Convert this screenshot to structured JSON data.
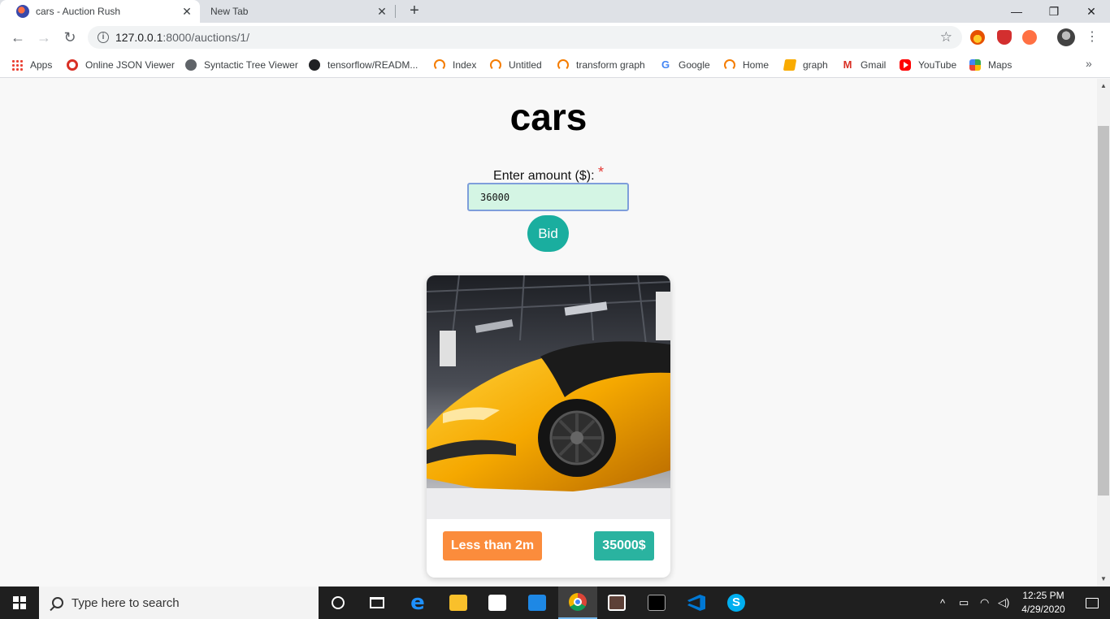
{
  "browser": {
    "tabs": [
      {
        "title": "cars - Auction Rush",
        "close": "✕"
      },
      {
        "title": "New Tab",
        "close": "✕"
      }
    ],
    "new_tab": "+",
    "window_controls": {
      "minimize": "—",
      "maximize": "❐",
      "close": "✕"
    },
    "nav": {
      "back": "←",
      "forward": "→",
      "reload": "↻"
    },
    "url_host": "127.0.0.1",
    "url_path": ":8000/auctions/1/",
    "bookmark_star": "☆",
    "menu": "⋮",
    "bookmarks": [
      {
        "label": "Apps",
        "icon": "apps-icon"
      },
      {
        "label": "Online JSON Viewer",
        "icon": "ring-icon"
      },
      {
        "label": "Syntactic Tree Viewer",
        "icon": "globe-icon"
      },
      {
        "label": "tensorflow/READM...",
        "icon": "github-icon"
      },
      {
        "label": "Index",
        "icon": "arc-icon"
      },
      {
        "label": "Untitled",
        "icon": "arc-icon"
      },
      {
        "label": "transform graph",
        "icon": "arc-icon"
      },
      {
        "label": "Google",
        "icon": "google-icon"
      },
      {
        "label": "Home",
        "icon": "arc-icon"
      },
      {
        "label": "graph",
        "icon": "note-icon"
      },
      {
        "label": "Gmail",
        "icon": "gmail-icon"
      },
      {
        "label": "YouTube",
        "icon": "youtube-icon"
      },
      {
        "label": "Maps",
        "icon": "maps-icon"
      }
    ],
    "bookmarks_more": "»"
  },
  "page": {
    "title": "cars",
    "amount_label": "Enter amount ($):",
    "required_mark": "*",
    "amount_value": "36000",
    "bid_label": "Bid",
    "card": {
      "time_left": "Less than 2m",
      "price": "35000$"
    }
  },
  "taskbar": {
    "search_placeholder": "Type here to search",
    "time": "12:25 PM",
    "date": "4/29/2020",
    "tray_chevron": "^"
  },
  "colors": {
    "bid_button": "#1aae9f",
    "time_badge": "#fb8c3c",
    "price_badge": "#2ab3a0",
    "input_bg": "#d4f5e4",
    "required": "#e53935"
  }
}
